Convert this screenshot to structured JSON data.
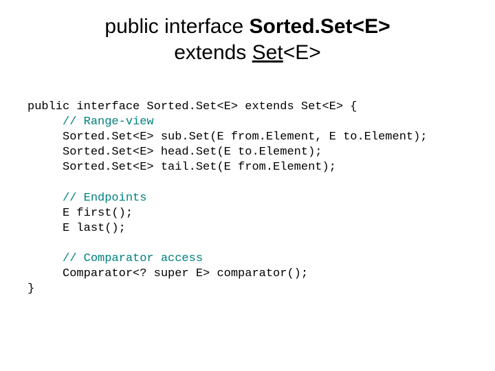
{
  "title": {
    "line1_plain": "public interface ",
    "line1_bold": "Sorted.Set<E>",
    "line2_plain": "extends ",
    "line2_link": "Set",
    "line2_tail": "<E>"
  },
  "code": {
    "l1": "public interface Sorted.Set<E> extends Set<E> {",
    "l2": "     // Range-view",
    "l3": "     Sorted.Set<E> sub.Set(E from.Element, E to.Element);",
    "l4": "     Sorted.Set<E> head.Set(E to.Element);",
    "l5": "     Sorted.Set<E> tail.Set(E from.Element);",
    "l6": "",
    "l7": "     // Endpoints",
    "l8": "     E first();",
    "l9": "     E last();",
    "l10": "",
    "l11": "     // Comparator access",
    "l12": "     Comparator<? super E> comparator();",
    "l13": "}"
  }
}
